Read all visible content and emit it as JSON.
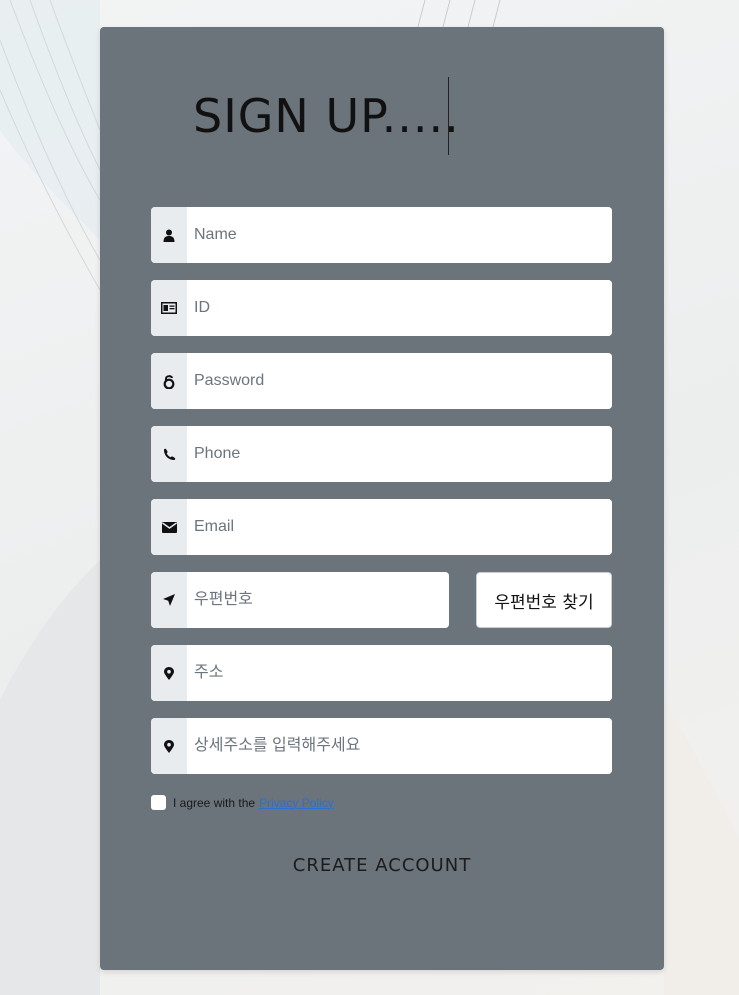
{
  "form": {
    "title": "SIGN UP.....",
    "fields": [
      {
        "icon": "user-icon",
        "placeholder": "Name"
      },
      {
        "icon": "id-card-icon",
        "placeholder": "ID"
      },
      {
        "icon": "lock-icon",
        "placeholder": "Password"
      },
      {
        "icon": "phone-icon",
        "placeholder": "Phone"
      },
      {
        "icon": "envelope-icon",
        "placeholder": "Email"
      },
      {
        "icon": "location-arrow-icon",
        "placeholder": "우편번호"
      },
      {
        "icon": "map-marker-icon",
        "placeholder": "주소"
      },
      {
        "icon": "map-marker-icon",
        "placeholder": "상세주소를 입력해주세요"
      }
    ],
    "zip_search_label": "우편번호 찾기",
    "agree": {
      "text": "I agree with the",
      "link_text": "Privacy Policy"
    },
    "submit_label": "CREATE ACCOUNT"
  },
  "colors": {
    "card": "#6b737b",
    "addon": "#e9ecef",
    "link": "#2a6fd6"
  }
}
